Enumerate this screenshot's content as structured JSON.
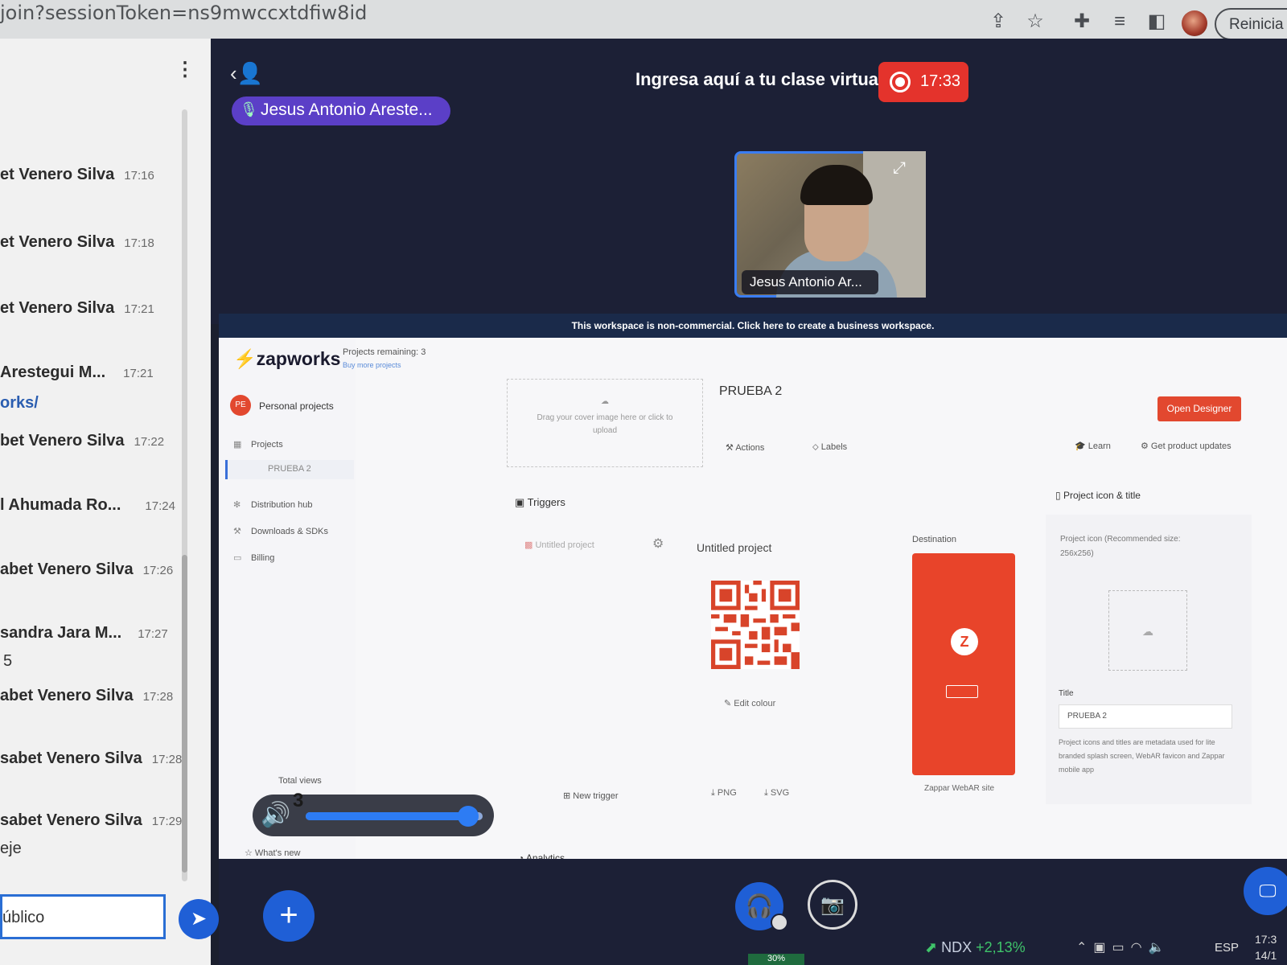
{
  "browser": {
    "url": "join?sessionToken=ns9mwccxtdfiw8id",
    "restart_label": "Reinicia p",
    "icons": [
      "share-icon",
      "star-icon",
      "extensions-icon",
      "reading-list-icon",
      "sidebar-icon"
    ]
  },
  "chat": {
    "messages": [
      {
        "sender": "et Venero Silva",
        "time": "17:16"
      },
      {
        "sender": "et Venero Silva",
        "time": "17:18"
      },
      {
        "sender": "et Venero Silva",
        "time": "17:21"
      },
      {
        "sender": "Arestegui M...",
        "time": "17:21",
        "text": "orks/"
      },
      {
        "sender": "bet Venero Silva",
        "time": "17:22"
      },
      {
        "sender": "l Ahumada Ro...",
        "time": "17:24"
      },
      {
        "sender": "abet Venero Silva",
        "time": "17:26"
      },
      {
        "sender": "sandra Jara M...",
        "time": "17:27",
        "text": "5"
      },
      {
        "sender": "abet Venero Silva",
        "time": "17:28"
      },
      {
        "sender": "sabet Venero Silva",
        "time": "17:28"
      },
      {
        "sender": "sabet Venero Silva",
        "time": "17:29",
        "text": "eje"
      }
    ],
    "input_value": "úblico"
  },
  "meeting": {
    "title": "Ingresa aquí a tu clase virtual",
    "timer": "17:33",
    "talker": "Jesus Antonio Areste...",
    "webcam_name": "Jesus Antonio Ar...",
    "notice": "This workspace is non-commercial. Click here to create a business workspace."
  },
  "zapworks": {
    "logo": "zapworks",
    "remaining": "Projects remaining: 3",
    "buy_more": "Buy more projects",
    "avatar_initials": "PE",
    "personal_projects": "Personal projects",
    "nav": {
      "projects": "Projects",
      "prueba": "PRUEBA 2",
      "distribution": "Distribution hub",
      "downloads": "Downloads & SDKs",
      "billing": "Billing"
    },
    "cover_upload": "Drag your cover image here or click to upload",
    "project_title": "PRUEBA 2",
    "open_designer": "Open Designer",
    "actions": "Actions",
    "labels": "Labels",
    "learn": "Learn",
    "updates": "Get product updates",
    "triggers": "Triggers",
    "trigger_item": "Untitled project",
    "untitled": "Untitled project",
    "edit_colour": "Edit colour",
    "new_trigger": "New trigger",
    "png": "PNG",
    "svg": "SVG",
    "destination": "Destination",
    "zappar_site": "Zappar WebAR site",
    "icon_title_header": "Project icon & title",
    "project_icon_label": "Project icon (Recommended size: 256x256)",
    "title_label": "Title",
    "title_value": "PRUEBA 2",
    "meta_note": "Project icons and titles are metadata used for lite branded splash screen, WebAR favicon and Zappar mobile app",
    "total_views": "Total views",
    "whats_new": "What's new",
    "analytics": "Analytics"
  },
  "volume": {
    "value": "3",
    "level_percent": 92
  },
  "bottom": {
    "meter": "30%"
  },
  "taskbar": {
    "ndx": "NDX",
    "change": "+2,13%",
    "lang": "ESP",
    "time": "17:3",
    "date": "14/1"
  },
  "colors": {
    "accent": "#1f5fd6",
    "record": "#e4332c",
    "zap_orange": "#e2482f",
    "talker": "#5b3fc7"
  }
}
